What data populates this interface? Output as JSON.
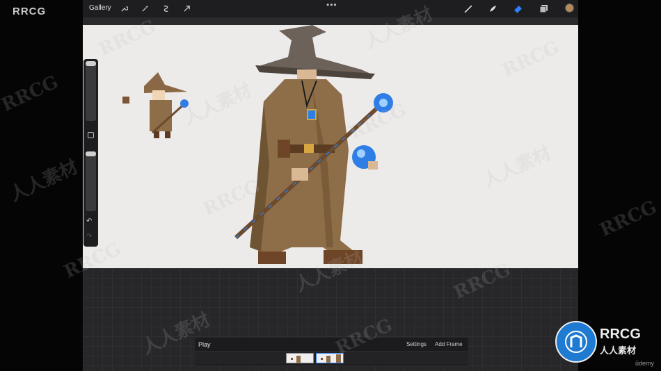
{
  "watermark": {
    "logo": "RRCG",
    "cn_text": "人人素材",
    "badge_title": "RRCG",
    "badge_sub": "人人素材",
    "udemy": "ūdemy"
  },
  "toolbar": {
    "gallery_label": "Gallery",
    "more_label": "•••",
    "color_swatch": "#b28a5c",
    "tools": [
      "wrench-icon",
      "magic-wand-icon",
      "selection-icon",
      "transform-arrow-icon",
      "brush-icon",
      "smudge-icon",
      "eraser-icon",
      "layers-icon"
    ]
  },
  "sidebar": {
    "undo_label": "↶",
    "redo_label": "↷"
  },
  "animation": {
    "play_label": "Play",
    "settings_label": "Settings",
    "add_frame_label": "Add Frame",
    "frame_count": 2,
    "active_frame": 2
  },
  "colors": {
    "canvas": "#edeaea",
    "robe": "#8e6e48",
    "hat": "#6d625a",
    "orb": "#2f7ee6",
    "accent": "#2a7fff"
  }
}
